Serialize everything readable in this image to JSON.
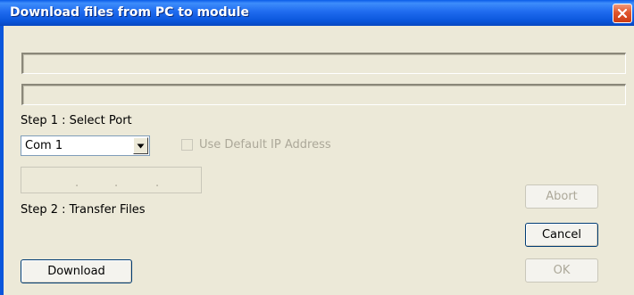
{
  "window": {
    "title": "Download files from PC to module",
    "close_icon": "close-icon"
  },
  "progress": {
    "path_line_1": "",
    "path_line_2": ""
  },
  "step1": {
    "label": "Step 1 : Select Port",
    "port_selected": "Com 1",
    "use_default_ip_label": "Use Default IP Address",
    "use_default_ip_checked": false,
    "ip_address_separators": [
      ".",
      ".",
      "."
    ]
  },
  "step2": {
    "label": "Step 2 : Transfer Files"
  },
  "buttons": {
    "abort": "Abort",
    "cancel": "Cancel",
    "ok": "OK",
    "download": "Download"
  },
  "colors": {
    "titlebar": "#0a56dc",
    "dialog_bg": "#ece9d8",
    "close_button": "#e0552c",
    "disabled_text": "#aca899"
  }
}
